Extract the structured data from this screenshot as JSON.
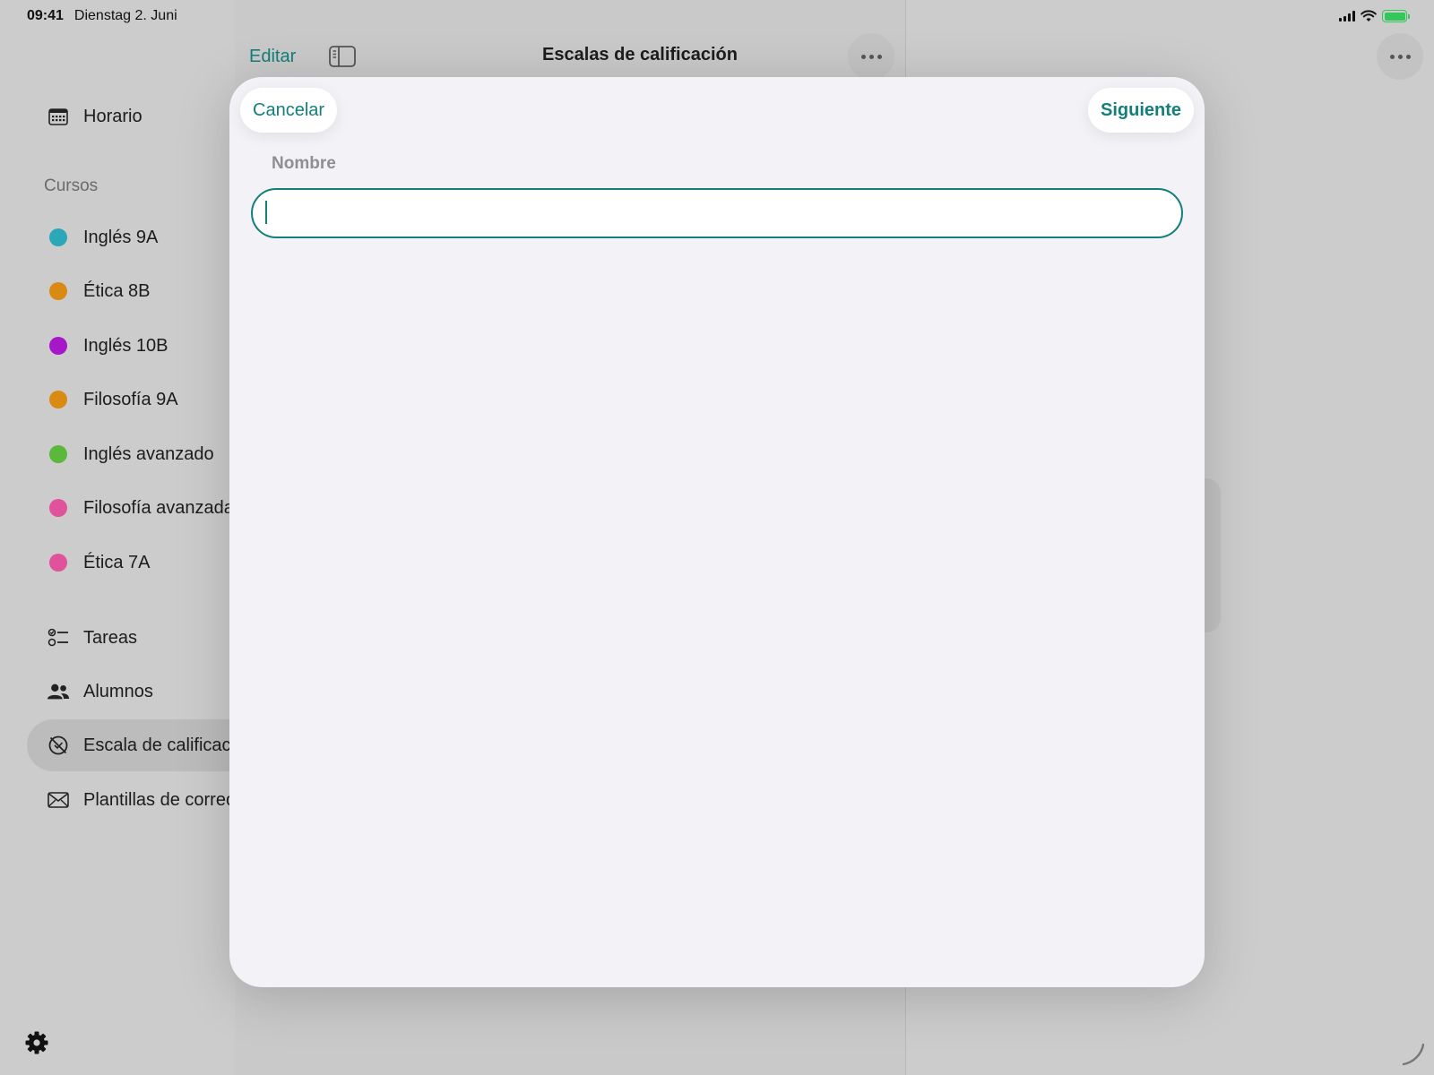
{
  "status_bar": {
    "time": "09:41",
    "date": "Dienstag 2. Juni"
  },
  "list_header": {
    "edit_label": "Editar",
    "title": "Escalas de calificación"
  },
  "sidebar": {
    "schedule_label": "Horario",
    "courses_section_label": "Cursos",
    "courses": [
      {
        "label": "Inglés 9A",
        "color": "#2aa8b8"
      },
      {
        "label": "Ética 8B",
        "color": "#d98a12"
      },
      {
        "label": "Inglés 10B",
        "color": "#a517c9"
      },
      {
        "label": "Filosofía 9A",
        "color": "#d98a12"
      },
      {
        "label": "Inglés avanzado",
        "color": "#5cb83a"
      },
      {
        "label": "Filosofía avanzada",
        "color": "#e0529a"
      },
      {
        "label": "Ética 7A",
        "color": "#e0529a"
      }
    ],
    "tasks_label": "Tareas",
    "students_label": "Alumnos",
    "grading_scale_label": "Escala de calificación",
    "email_templates_label": "Plantillas de correo"
  },
  "sheet": {
    "cancel_label": "Cancelar",
    "next_label": "Siguiente",
    "name_label": "Nombre",
    "name_value": "",
    "name_placeholder": ""
  },
  "colors": {
    "accent": "#137e7a"
  }
}
